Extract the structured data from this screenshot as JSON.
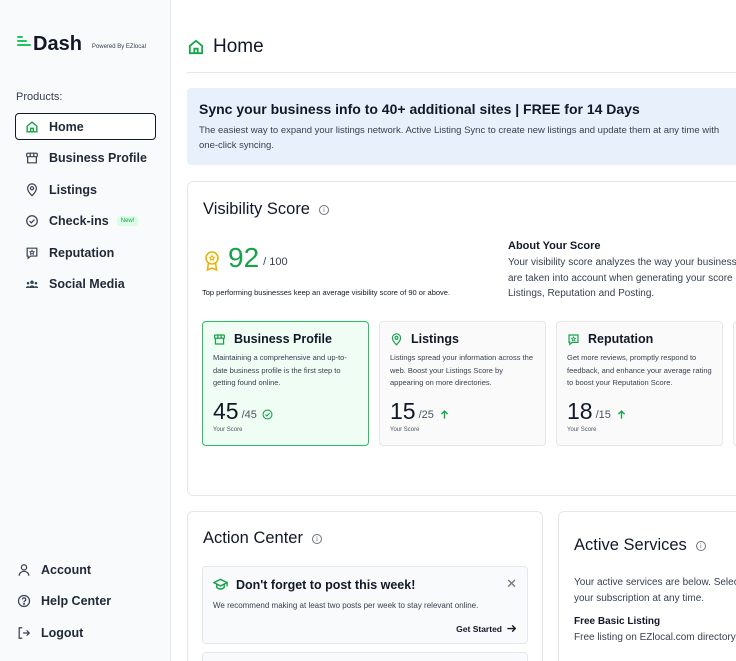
{
  "brand": {
    "name": "Dash",
    "powered_by": "Powered By EZlocal",
    "accent": "#22c55e"
  },
  "sidebar": {
    "products_label": "Products:",
    "items": [
      {
        "label": "Home",
        "icon": "home-icon",
        "active": true
      },
      {
        "label": "Business Profile",
        "icon": "storefront-icon"
      },
      {
        "label": "Listings",
        "icon": "map-pin-icon"
      },
      {
        "label": "Check-ins",
        "icon": "check-circle-icon",
        "badge": "New!"
      },
      {
        "label": "Reputation",
        "icon": "star-message-icon"
      },
      {
        "label": "Social Media",
        "icon": "users-icon"
      }
    ],
    "bottom": [
      {
        "label": "Account",
        "icon": "user-icon"
      },
      {
        "label": "Help Center",
        "icon": "help-icon"
      },
      {
        "label": "Logout",
        "icon": "logout-icon"
      }
    ]
  },
  "header": {
    "title": "Home"
  },
  "banner": {
    "title": "Sync your business info to 40+ additional sites | FREE for 14 Days",
    "description": "The easiest way to expand your listings network. Active Listing Sync to create new listings and update them at any time with one-click syncing."
  },
  "visibility": {
    "title": "Visibility Score",
    "score": "92",
    "max": "/ 100",
    "note": "Top performing businesses keep an average visibility score of 90 or above.",
    "about_title": "About Your Score",
    "about_lines": [
      "Your visibility score analyzes the way your business",
      "are taken into account when generating your score",
      "Listings, Reputation and Posting."
    ],
    "cards": [
      {
        "title": "Business Profile",
        "desc": "Maintaining a comprehensive and up-to-date business profile is the first step to getting found online.",
        "score": "45",
        "max": "/45",
        "status": "check",
        "label": "Your Score"
      },
      {
        "title": "Listings",
        "desc": "Listings spread your information across the web. Boost your Listings Score by appearing on more directories.",
        "score": "15",
        "max": "/25",
        "status": "up",
        "label": "Your Score"
      },
      {
        "title": "Reputation",
        "desc": "Get more reviews, promptly respond to feedback, and enhance your average rating to boost your Reputation Score.",
        "score": "18",
        "max": "/15",
        "status": "up",
        "label": "Your Score"
      }
    ]
  },
  "action_center": {
    "title": "Action Center",
    "notice_title": "Don't forget to post this week!",
    "notice_desc": "We recommend making at least two posts per week to stay relevant online.",
    "cta": "Get Started"
  },
  "services": {
    "title": "Active Services",
    "desc_lines": [
      "Your active services are below. Selec",
      "your subscription at any time."
    ],
    "item_name": "Free Basic Listing",
    "item_desc": "Free listing on EZlocal.com directory"
  }
}
